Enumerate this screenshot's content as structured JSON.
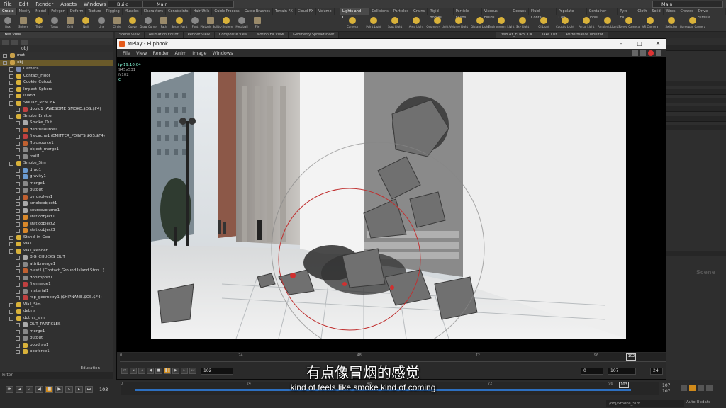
{
  "menubar": {
    "items": [
      "File",
      "Edit",
      "Render",
      "Assets",
      "Windows",
      "Help"
    ],
    "build": "Build",
    "desktop": "Main",
    "desktop_right": "Main"
  },
  "shelf": {
    "tabs_left": [
      "Create",
      "Modify",
      "Model",
      "Polygon",
      "Deform",
      "Texture",
      "Rigging",
      "Muscles",
      "Characters",
      "Constraints",
      "Hair Utils",
      "Guide Process",
      "Guide Brushes",
      "Terrain FX",
      "Cloud FX",
      "Volume"
    ],
    "tabs_right": [
      "Lights and C...",
      "Collisions",
      "Particles",
      "Grains",
      "Rigid Bodies",
      "Particle Fluids",
      "Viscous Fluids",
      "Oceans",
      "Fluid Conta...",
      "Populate Con...",
      "Container Tools",
      "Pyro FX",
      "Cloth",
      "Solid",
      "Wires",
      "Crowds",
      "Drive Simula..."
    ],
    "tools_left": [
      "Box",
      "Sphere",
      "Tube",
      "Torus",
      "Grid",
      "Null",
      "Line",
      "Circle",
      "Curve",
      "Draw Curve",
      "Path",
      "Spray Paint",
      "Font",
      "Platonic Solids",
      "L-System",
      "Metaball",
      "File"
    ],
    "tools_right": [
      "Camera",
      "Point Light",
      "Spot Light",
      "Area Light",
      "Geometry Light",
      "Volume Light",
      "Distant Light",
      "Environment Light",
      "Sky Light",
      "GI Light",
      "Caustic Light",
      "Portal Light",
      "Ambient Light",
      "Stereo Camera",
      "VR Camera",
      "Switcher",
      "Gamepad Camera"
    ]
  },
  "pane_tabs": [
    "Scene View",
    "Animation Editor",
    "Render View",
    "Composite View",
    "Motion FX View",
    "Geometry Spreadsheet"
  ],
  "pane_tabs_right": [
    "/MPLAY_FLIPBOOK",
    "Take List",
    "Performance Monitor"
  ],
  "tree": {
    "tab": "Tree View",
    "path": "obj",
    "filter_label": "Filter",
    "rows": [
      {
        "label": "mat",
        "indent": 0,
        "color": "#c8a04a"
      },
      {
        "label": "obj",
        "indent": 0,
        "color": "#c8a04a",
        "selected": true
      },
      {
        "label": "Camera",
        "indent": 1,
        "color": "#7a8ab0"
      },
      {
        "label": "Contact_Floor",
        "indent": 1,
        "color": "#d9b23a"
      },
      {
        "label": "Cookie_Cutout",
        "indent": 1,
        "color": "#d9b23a"
      },
      {
        "label": "Impact_Sphere",
        "indent": 1,
        "color": "#d9b23a"
      },
      {
        "label": "Island",
        "indent": 1,
        "color": "#d9b23a"
      },
      {
        "label": "SMOKE_RENDER",
        "indent": 1,
        "color": "#d9b23a"
      },
      {
        "label": "dopio1 (AWESOME_SMOKE.$OS.$F4)",
        "indent": 2,
        "color": "#c04040"
      },
      {
        "label": "Smoke_Emitter",
        "indent": 1,
        "color": "#d9b23a"
      },
      {
        "label": "Smoke_Out",
        "indent": 2,
        "color": "#aaaaaa"
      },
      {
        "label": "debrissource1",
        "indent": 2,
        "color": "#c06030"
      },
      {
        "label": "filecache1 (EMITTER_POINTS.$OS.$F4)",
        "indent": 2,
        "color": "#c04040"
      },
      {
        "label": "fluidsource1",
        "indent": 2,
        "color": "#c06030"
      },
      {
        "label": "object_merge1",
        "indent": 2,
        "color": "#888888"
      },
      {
        "label": "trail1",
        "indent": 2,
        "color": "#888888"
      },
      {
        "label": "Smoke_Sim",
        "indent": 1,
        "color": "#d9b23a"
      },
      {
        "label": "drag1",
        "indent": 2,
        "color": "#6a9ad0"
      },
      {
        "label": "gravity1",
        "indent": 2,
        "color": "#6a9ad0"
      },
      {
        "label": "merge1",
        "indent": 2,
        "color": "#888888"
      },
      {
        "label": "output",
        "indent": 2,
        "color": "#888888"
      },
      {
        "label": "pyrosolver1",
        "indent": 2,
        "color": "#c06030"
      },
      {
        "label": "smokeobject1",
        "indent": 2,
        "color": "#aaaaaa"
      },
      {
        "label": "sourcevolume1",
        "indent": 2,
        "color": "#aaaaaa"
      },
      {
        "label": "staticobject1",
        "indent": 2,
        "color": "#d9882a"
      },
      {
        "label": "staticobject2",
        "indent": 2,
        "color": "#d9882a"
      },
      {
        "label": "staticobject3",
        "indent": 2,
        "color": "#d9882a"
      },
      {
        "label": "Stand_in_Geo",
        "indent": 1,
        "color": "#d9b23a"
      },
      {
        "label": "Wall",
        "indent": 1,
        "color": "#d9b23a"
      },
      {
        "label": "Wall_Render",
        "indent": 1,
        "color": "#d9b23a"
      },
      {
        "label": "BIG_CHUCKS_OUT",
        "indent": 2,
        "color": "#aaaaaa"
      },
      {
        "label": "attribmerge1",
        "indent": 2,
        "color": "#888888"
      },
      {
        "label": "blast1 (Contact_Ground Island Ston...)",
        "indent": 2,
        "color": "#c06030"
      },
      {
        "label": "dopimport1",
        "indent": 2,
        "color": "#888888"
      },
      {
        "label": "filemerge1",
        "indent": 2,
        "color": "#c04040"
      },
      {
        "label": "material1",
        "indent": 2,
        "color": "#888888"
      },
      {
        "label": "rop_geometry1 ($HIPNAME.$OS.$F4)",
        "indent": 2,
        "color": "#c04040"
      },
      {
        "label": "Wall_Sim",
        "indent": 1,
        "color": "#d9b23a"
      },
      {
        "label": "debris",
        "indent": 1,
        "color": "#d9b23a"
      },
      {
        "label": "dotrvs_sim",
        "indent": 1,
        "color": "#d9b23a"
      },
      {
        "label": "OUT_PARTICLES",
        "indent": 2,
        "color": "#aaaaaa"
      },
      {
        "label": "merge1",
        "indent": 2,
        "color": "#888888"
      },
      {
        "label": "output",
        "indent": 2,
        "color": "#888888"
      },
      {
        "label": "popdrag1",
        "indent": 2,
        "color": "#d9b23a"
      },
      {
        "label": "popforce1",
        "indent": 2,
        "color": "#d9b23a"
      }
    ],
    "edu_badge": "Education"
  },
  "mplay": {
    "title": "MPlay - Flipbook",
    "menu": [
      "File",
      "View",
      "Render",
      "Anim",
      "Image",
      "Windows"
    ],
    "hud": [
      "ip-19:10:04",
      "945x531",
      "fr102",
      "C"
    ],
    "timeline_ticks": [
      [
        "0",
        0
      ],
      [
        "24",
        0.22
      ],
      [
        "48",
        0.44
      ],
      [
        "72",
        0.66
      ],
      [
        "96",
        0.88
      ]
    ],
    "current_frame": "102",
    "current_pos": 0.94,
    "frame_field": "102",
    "start_field": "0",
    "end_field": "107",
    "fps_field": "24"
  },
  "main_timeline": {
    "frame": "103",
    "ticks": [
      [
        "0",
        0
      ],
      [
        "24",
        0.24
      ],
      [
        "48",
        0.47
      ],
      [
        "72",
        0.7
      ],
      [
        "96",
        0.93
      ]
    ],
    "current_frame": "103",
    "current_pos": 0.95,
    "range_end_top": "107",
    "range_end_bottom": "107",
    "status_path": "/obj/Smoke_Sim",
    "auto_update": "Auto Update"
  },
  "right_panel": {
    "watermark": "Scene"
  },
  "subtitles": {
    "cn": "有点像冒烟的感觉",
    "en": "kind of feels like smoke kind of coming"
  }
}
